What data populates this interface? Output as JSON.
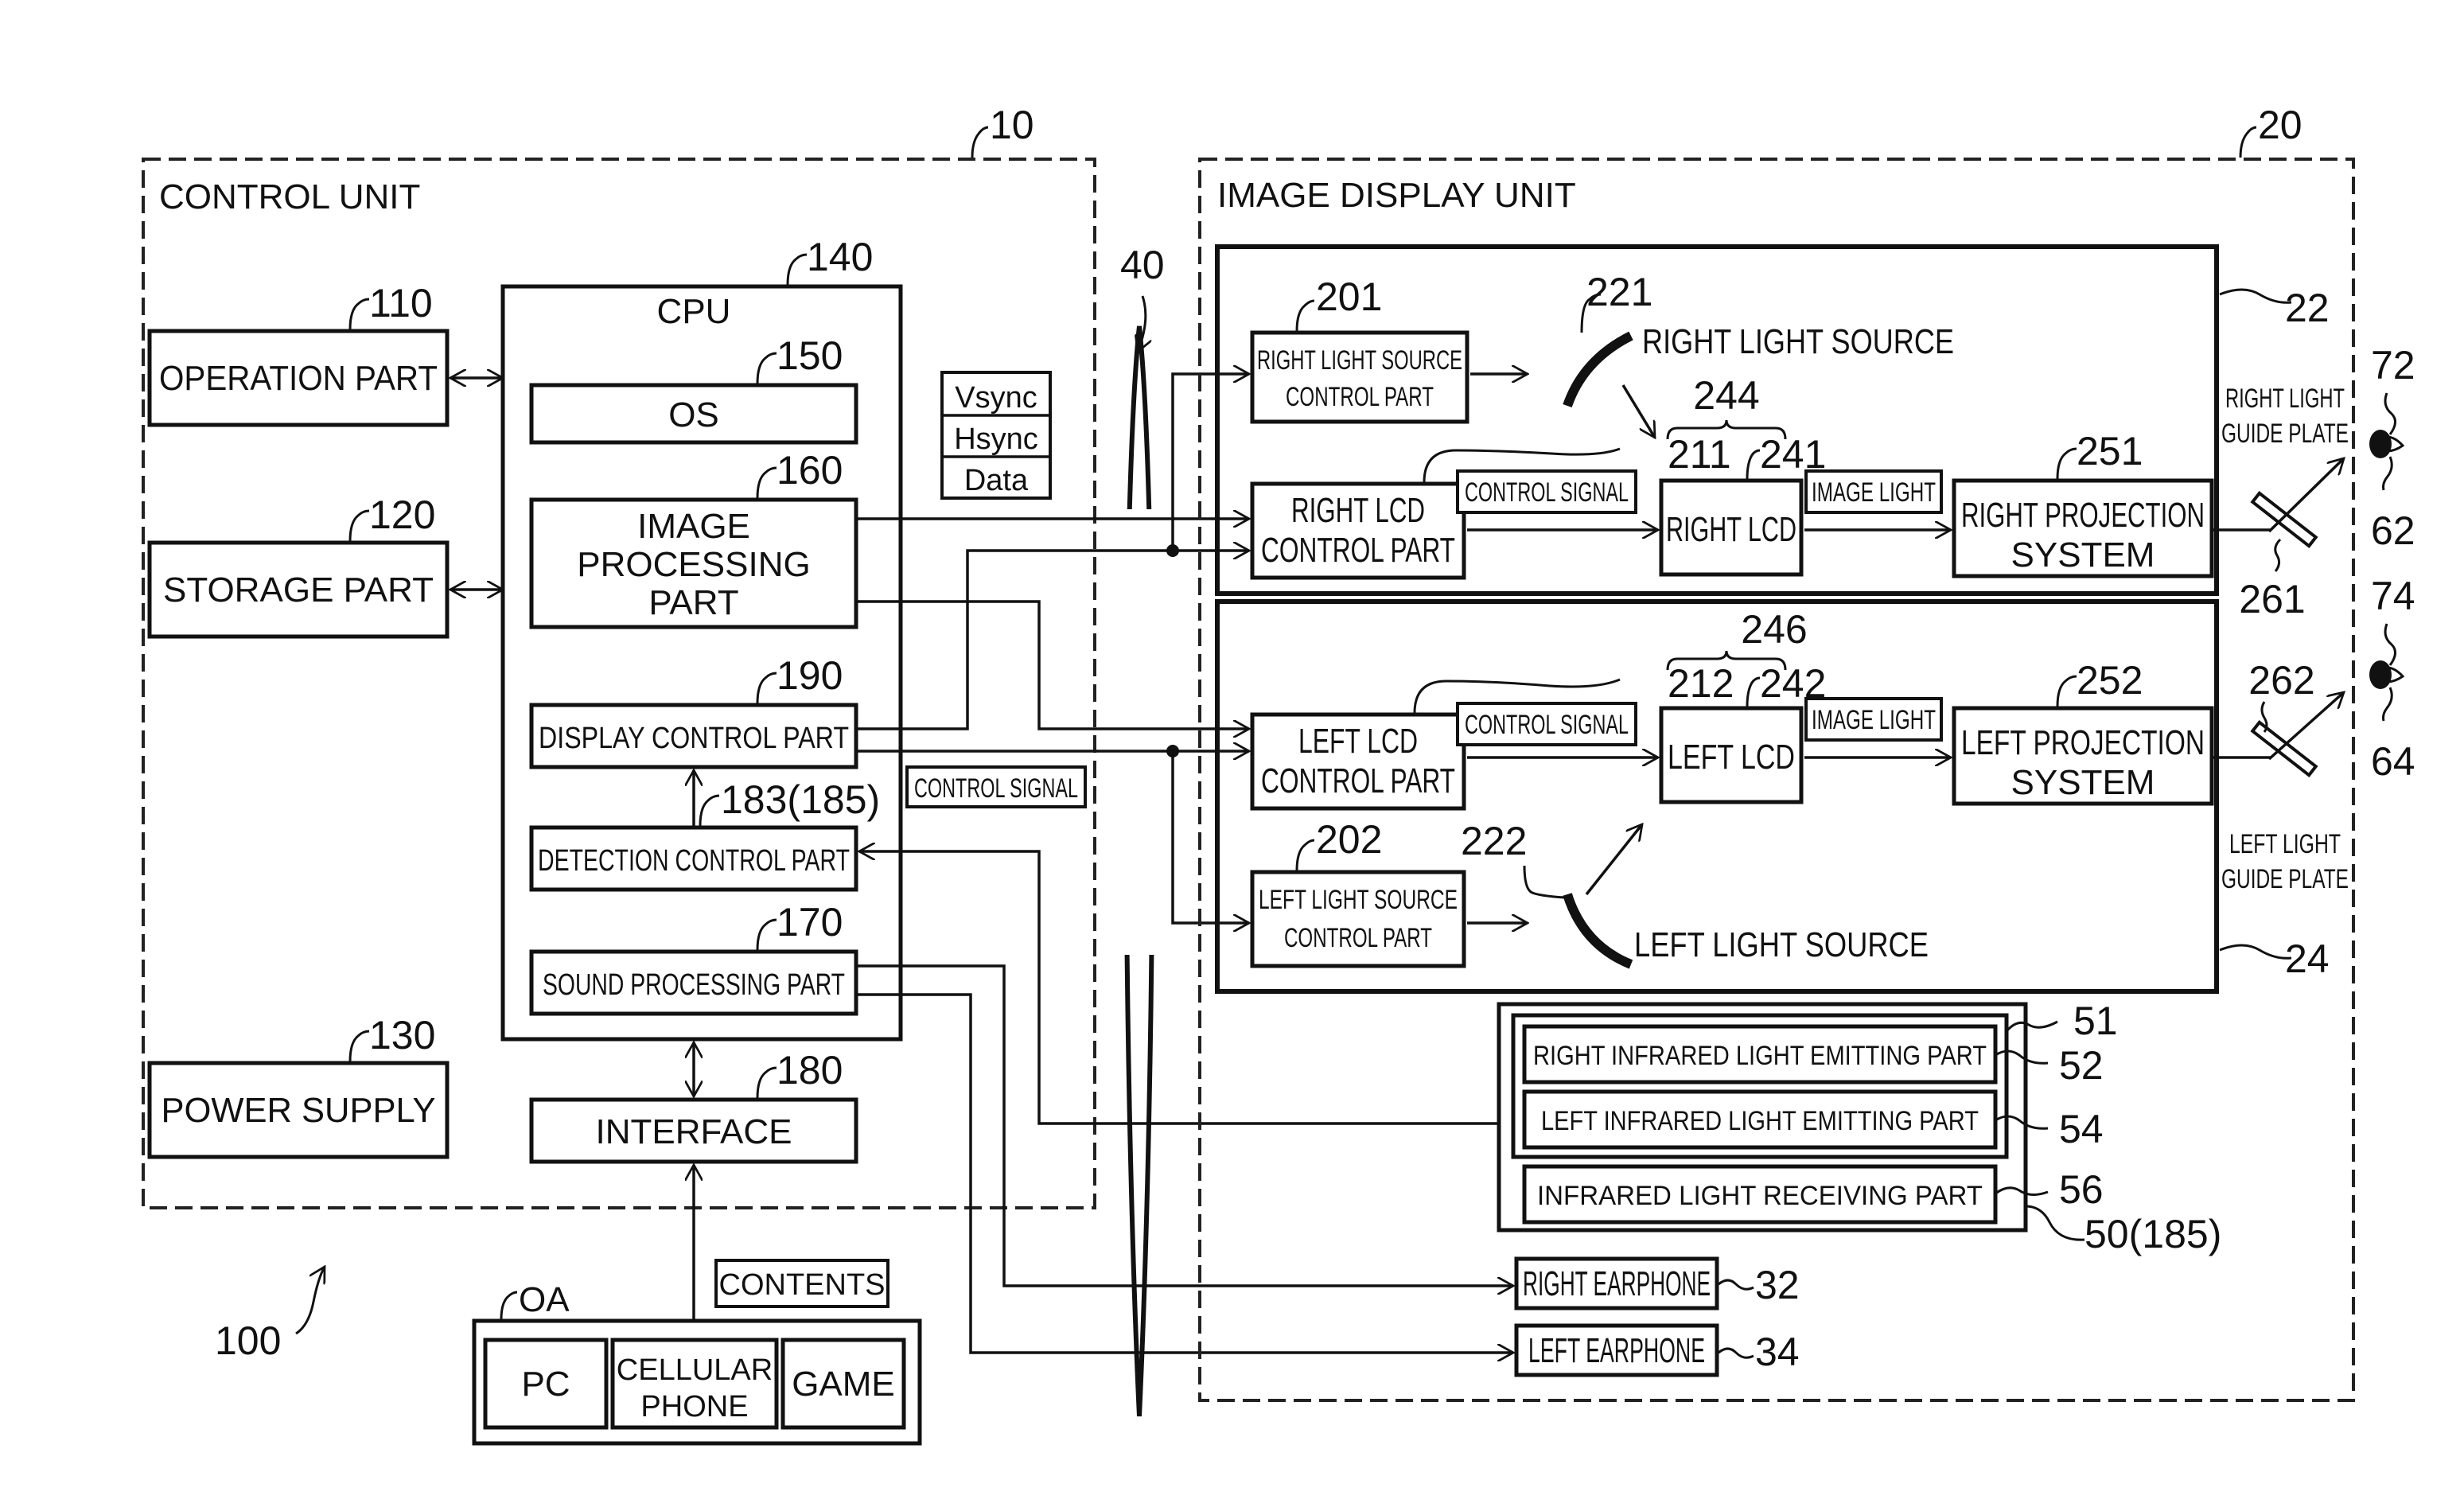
{
  "figure": {
    "system_ref": "100",
    "control_unit": {
      "title": "CONTROL UNIT",
      "ref": "10",
      "operation_part": {
        "label": "OPERATION PART",
        "ref": "110"
      },
      "storage_part": {
        "label": "STORAGE PART",
        "ref": "120"
      },
      "power_supply": {
        "label": "POWER SUPPLY",
        "ref": "130"
      },
      "cpu": {
        "label": "CPU",
        "ref": "140",
        "os": {
          "label": "OS",
          "ref": "150"
        },
        "image_processing": {
          "line1": "IMAGE",
          "line2": "PROCESSING",
          "line3": "PART",
          "ref": "160"
        },
        "display_control": {
          "label": "DISPLAY CONTROL PART",
          "ref": "190"
        },
        "detection_control": {
          "label": "DETECTION CONTROL PART",
          "ref": "183(185)"
        },
        "sound_processing": {
          "label": "SOUND PROCESSING PART",
          "ref": "170"
        }
      },
      "interface": {
        "label": "INTERFACE",
        "ref": "180"
      },
      "signal_table": [
        "Vsync",
        "Hsync",
        "Data"
      ],
      "control_signal_tag": "CONTROL SIGNAL"
    },
    "cable_ref": "40",
    "external": {
      "ref": "OA",
      "contents_tag": "CONTENTS",
      "devices": [
        {
          "line1": "PC",
          "line2": ""
        },
        {
          "line1": "CELLULAR",
          "line2": "PHONE"
        },
        {
          "line1": "GAME",
          "line2": ""
        }
      ]
    },
    "image_display_unit": {
      "title": "IMAGE DISPLAY UNIT",
      "ref": "20",
      "right_display": {
        "ref": "22",
        "light_source_control": {
          "line1": "RIGHT LIGHT SOURCE",
          "line2": "CONTROL PART",
          "ref": "201"
        },
        "light_source": {
          "label": "RIGHT LIGHT SOURCE",
          "ref": "221"
        },
        "lcd_control": {
          "line1": "RIGHT LCD",
          "line2": "CONTROL PART",
          "ref": "211"
        },
        "lcd": {
          "label": "RIGHT LCD",
          "ref": "241"
        },
        "group_ref": "244",
        "projection": {
          "line1": "RIGHT PROJECTION",
          "line2": "SYSTEM",
          "ref": "251"
        },
        "control_signal_tag": "CONTROL SIGNAL",
        "image_light_tag": "IMAGE LIGHT"
      },
      "left_display": {
        "ref": "24",
        "light_source_control": {
          "line1": "LEFT LIGHT SOURCE",
          "line2": "CONTROL PART",
          "ref": "202"
        },
        "light_source": {
          "label": "LEFT LIGHT SOURCE",
          "ref": "222"
        },
        "lcd_control": {
          "line1": "LEFT LCD",
          "line2": "CONTROL PART",
          "ref": "212"
        },
        "lcd": {
          "label": "LEFT LCD",
          "ref": "242"
        },
        "group_ref": "246",
        "projection": {
          "line1": "LEFT PROJECTION",
          "line2": "SYSTEM",
          "ref": "252"
        },
        "control_signal_tag": "CONTROL SIGNAL",
        "image_light_tag": "IMAGE LIGHT"
      },
      "right_guide_plate": {
        "line1": "RIGHT LIGHT",
        "line2": "GUIDE PLATE",
        "ref": "261"
      },
      "left_guide_plate": {
        "line1": "LEFT LIGHT",
        "line2": "GUIDE PLATE",
        "ref": "262"
      },
      "infrared_unit": {
        "ref": "50(185)",
        "emitter_group_ref": "51",
        "right_emitter": {
          "label": "RIGHT INFRARED LIGHT EMITTING PART",
          "ref": "52"
        },
        "left_emitter": {
          "label": "LEFT INFRARED LIGHT EMITTING PART",
          "ref": "54"
        },
        "receiver": {
          "label": "INFRARED LIGHT RECEIVING PART",
          "ref": "56"
        }
      },
      "right_earphone": {
        "label": "RIGHT EARPHONE",
        "ref": "32"
      },
      "left_earphone": {
        "label": "LEFT EARPHONE",
        "ref": "34"
      }
    },
    "eyes": {
      "right": {
        "eye_ref": "62",
        "pupil_ref": "72"
      },
      "left": {
        "eye_ref": "64",
        "pupil_ref": "74"
      }
    }
  }
}
